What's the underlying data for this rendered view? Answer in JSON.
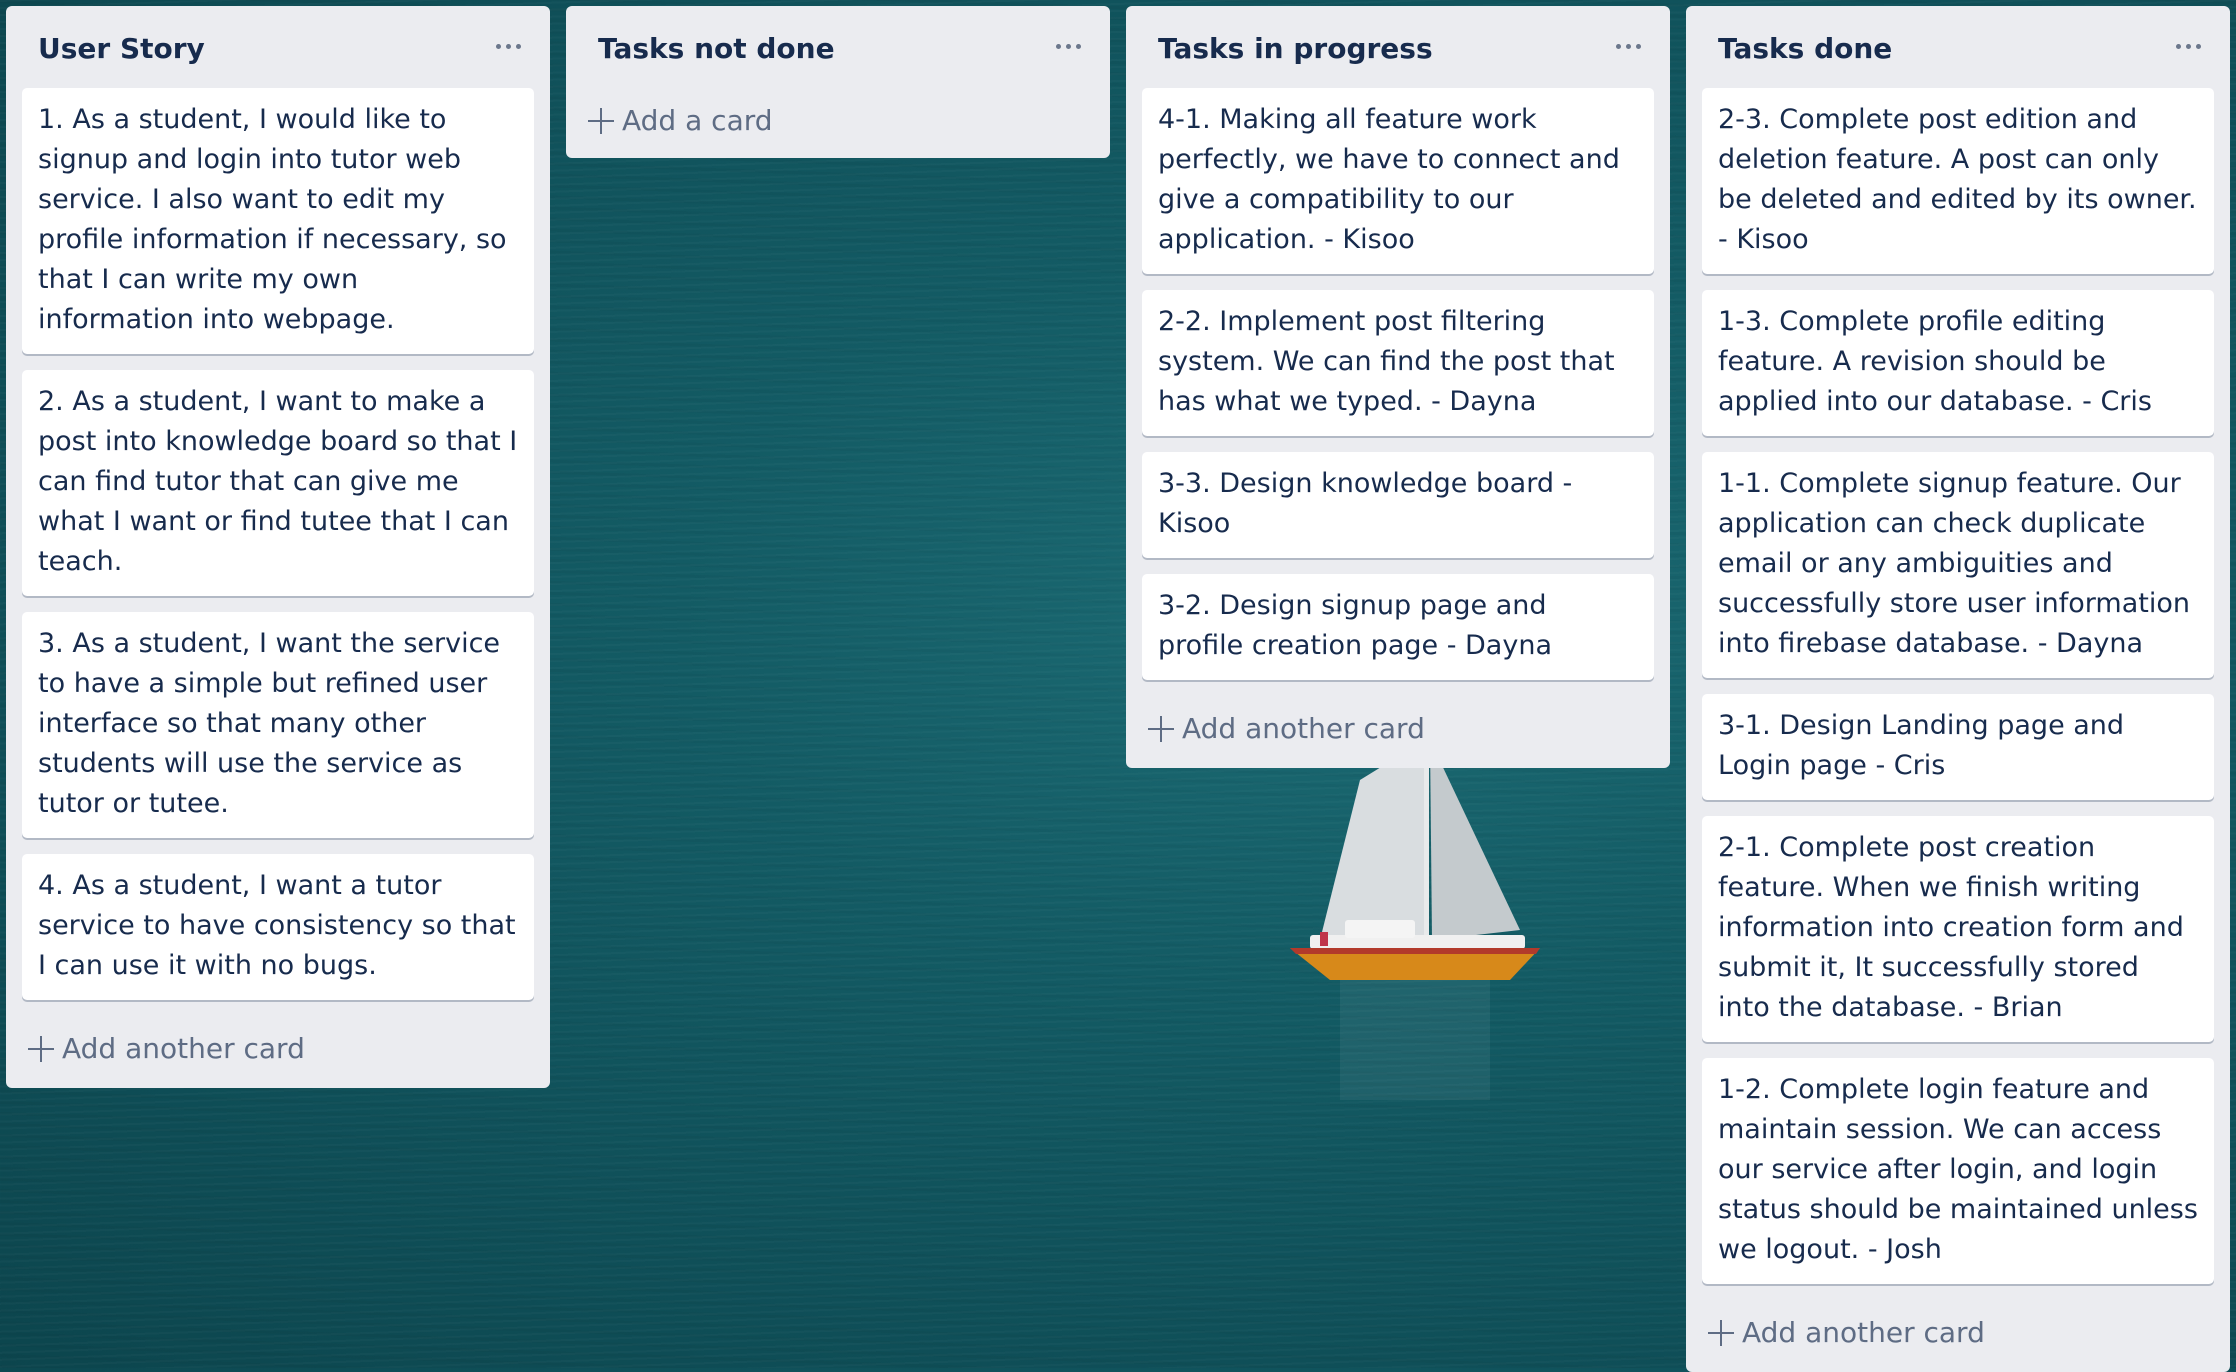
{
  "board": {
    "lists": [
      {
        "title": "User Story",
        "cards": [
          "1. As a student, I would like to signup and login into tutor web service. I also want to edit my profile information if necessary, so that I can write my own information into webpage.",
          "2. As a student, I want to make a post into knowledge board so that I can find tutor that can give me what I want or find tutee that I can teach.",
          "3. As a student, I want the service to have a simple but refined user interface so that many other students will use the service as tutor or tutee.",
          "4. As a student, I want a tutor service to have consistency so that I can use it with no bugs."
        ],
        "add_label": "Add another card"
      },
      {
        "title": "Tasks not done",
        "cards": [],
        "add_label": "Add a card"
      },
      {
        "title": "Tasks in progress",
        "cards": [
          "4-1. Making all feature work perfectly, we have to connect and give a compatibility to our application. - Kisoo",
          "2-2. Implement post filtering system. We can find the post that has what we typed. - Dayna",
          "3-3. Design knowledge board - Kisoo",
          "3-2. Design signup page and profile creation page - Dayna"
        ],
        "add_label": "Add another card"
      },
      {
        "title": "Tasks done",
        "cards": [
          "2-3. Complete post edition and deletion feature. A post can only be deleted and edited by its owner. - Kisoo",
          "1-3. Complete profile editing feature. A revision should be applied into our database. - Cris",
          "1-1. Complete signup feature. Our application can check duplicate email or any ambiguities and successfully store user information into firebase database. - Dayna",
          "3-1. Design Landing page and Login page - Cris",
          "2-1. Complete post creation feature. When we finish writing information into creation form and submit it, It successfully stored into the database. - Brian",
          "1-2. Complete login feature and maintain session. We can access our service after login, and login status should be maintained unless we logout. - Josh"
        ],
        "add_label": "Add another card"
      }
    ]
  },
  "icons": {
    "list_menu": "more-horizontal-icon",
    "add": "plus-icon"
  },
  "colors": {
    "list_background": "#ebecf0",
    "card_background": "#ffffff",
    "text": "#172b4d",
    "muted_text": "#5e6c84",
    "board_background": "#135b64"
  }
}
